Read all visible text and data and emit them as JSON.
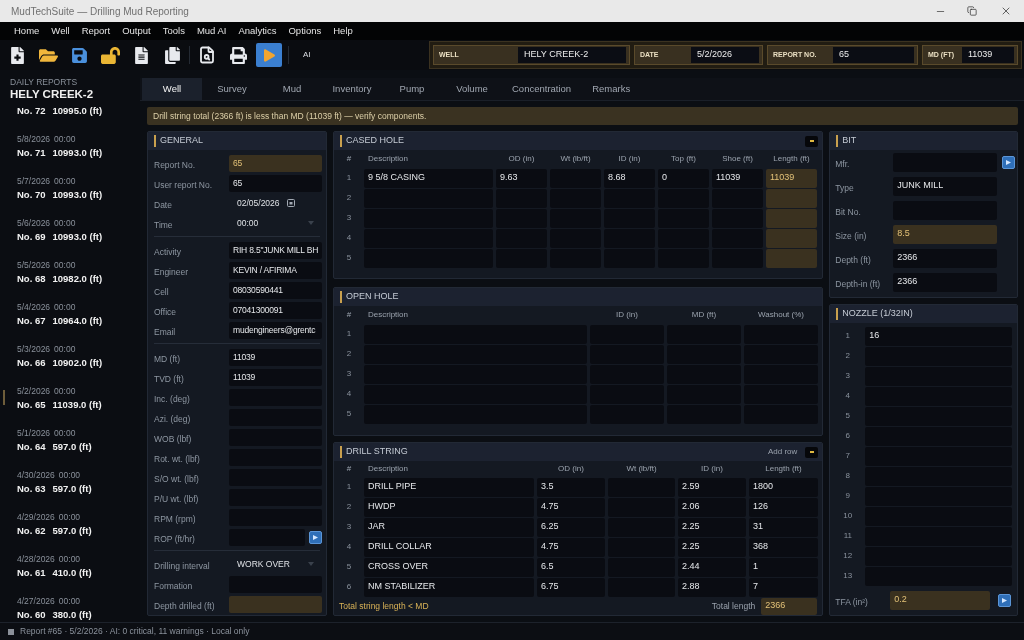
{
  "window": {
    "title": "MudTechSuite — Drilling Mud Reporting"
  },
  "menu": [
    "Home",
    "Well",
    "Report",
    "Output",
    "Tools",
    "Mud AI",
    "Analytics",
    "Options",
    "Help"
  ],
  "toolbar": {
    "groups": [
      {
        "buttons": [
          {
            "active": false
          },
          {
            "active": false
          },
          {
            "active": false
          },
          {
            "active": false
          },
          {
            "active": false
          },
          {
            "active": false
          }
        ]
      },
      {
        "buttons": [
          {
            "active": false
          },
          {
            "active": false
          },
          {
            "active": true
          }
        ]
      }
    ],
    "ai_button": "AI"
  },
  "header_fields": [
    {
      "label": "WELL",
      "value": "HELY CREEK-2"
    },
    {
      "label": "DATE",
      "value": "5/2/2026"
    },
    {
      "label": "REPORT NO.",
      "value": "65"
    },
    {
      "label": "MD (FT)",
      "value": "11039"
    }
  ],
  "sidebar": {
    "title": "DAILY REPORTS",
    "well": "HELY CREEK-2",
    "items": [
      {
        "number": "No. 72",
        "depth": "10995.0 (ft)",
        "selected": false
      },
      {
        "date": "5/8/2026",
        "time": "00:00",
        "number": "No. 71",
        "depth": "10993.0 (ft)",
        "selected": false
      },
      {
        "date": "5/7/2026",
        "time": "00:00",
        "number": "No. 70",
        "depth": "10993.0 (ft)",
        "selected": false
      },
      {
        "date": "5/6/2026",
        "time": "00:00",
        "number": "No. 69",
        "depth": "10993.0 (ft)",
        "selected": false
      },
      {
        "date": "5/5/2026",
        "time": "00:00",
        "number": "No. 68",
        "depth": "10982.0 (ft)",
        "selected": false
      },
      {
        "date": "5/4/2026",
        "time": "00:00",
        "number": "No. 67",
        "depth": "10964.0 (ft)",
        "selected": false
      },
      {
        "date": "5/3/2026",
        "time": "00:00",
        "number": "No. 66",
        "depth": "10902.0 (ft)",
        "selected": false
      },
      {
        "date": "5/2/2026",
        "time": "00:00",
        "number": "No. 65",
        "depth": "11039.0 (ft)",
        "selected": true
      },
      {
        "date": "5/1/2026",
        "time": "00:00",
        "number": "No. 64",
        "depth": "597.0 (ft)",
        "selected": false
      },
      {
        "date": "4/30/2026",
        "time": "00:00",
        "number": "No. 63",
        "depth": "597.0 (ft)",
        "selected": false
      },
      {
        "date": "4/29/2026",
        "time": "00:00",
        "number": "No. 62",
        "depth": "597.0 (ft)",
        "selected": false
      },
      {
        "date": "4/28/2026",
        "time": "00:00",
        "number": "No. 61",
        "depth": "410.0 (ft)",
        "selected": false
      },
      {
        "date": "4/27/2026",
        "time": "00:00",
        "number": "No. 60",
        "depth": "380.0 (ft)",
        "selected": false
      }
    ]
  },
  "tabs": [
    {
      "label": "Well",
      "selected": true
    },
    {
      "label": "Survey",
      "selected": false
    },
    {
      "label": "Mud",
      "selected": false
    },
    {
      "label": "Inventory",
      "selected": false
    },
    {
      "label": "Pump",
      "selected": false
    },
    {
      "label": "Volume",
      "selected": false
    },
    {
      "label": "Concentration",
      "selected": false
    },
    {
      "label": "Remarks",
      "selected": false
    }
  ],
  "warning": "Drill string total (2366 ft) is less than MD (11039 ft) — verify components.",
  "general": {
    "title": "GENERAL",
    "sections": [
      {
        "fields": [
          {
            "label": "Report No.",
            "kind": "text",
            "value": "65",
            "highlighted": true
          },
          {
            "label": "User report No.",
            "kind": "text",
            "value": "65",
            "highlighted": false
          },
          {
            "label": "Date",
            "kind": "date",
            "value": "02/05/2026",
            "highlighted": false
          },
          {
            "label": "Time",
            "kind": "time",
            "value": "00:00",
            "highlighted": false
          }
        ]
      },
      {
        "fields": [
          {
            "label": "Activity",
            "kind": "text",
            "value": "RIH 8.5\"JUNK MILL BH",
            "highlighted": false
          },
          {
            "label": "Engineer",
            "kind": "text",
            "value": "KEVIN / AFIRIMA",
            "highlighted": false
          },
          {
            "label": "Cell",
            "kind": "text",
            "value": "08030590441",
            "highlighted": false
          },
          {
            "label": "Office",
            "kind": "text",
            "value": "07041300091",
            "highlighted": false
          },
          {
            "label": "Email",
            "kind": "text",
            "value": "mudengineers@grentc",
            "highlighted": false
          }
        ]
      },
      {
        "fields": [
          {
            "label": "MD (ft)",
            "kind": "text",
            "value": "11039",
            "highlighted": false
          },
          {
            "label": "TVD (ft)",
            "kind": "text",
            "value": "11039",
            "highlighted": false
          },
          {
            "label": "Inc. (deg)",
            "kind": "text",
            "highlighted": false
          },
          {
            "label": "Azi. (deg)",
            "kind": "text",
            "highlighted": false
          },
          {
            "label": "WOB (lbf)",
            "kind": "text",
            "highlighted": false
          },
          {
            "label": "Rot. wt. (lbf)",
            "kind": "text",
            "highlighted": false
          },
          {
            "label": "S/O wt. (lbf)",
            "kind": "text",
            "highlighted": false
          },
          {
            "label": "P/U wt. (lbf)",
            "kind": "text",
            "highlighted": false
          },
          {
            "label": "RPM (rpm)",
            "kind": "text",
            "highlighted": false
          },
          {
            "label": "ROP (ft/hr)",
            "kind": "text_action",
            "highlighted": false
          }
        ]
      },
      {
        "fields": [
          {
            "label": "Drilling interval",
            "kind": "select",
            "value": "WORK OVER",
            "highlighted": false
          },
          {
            "label": "Formation",
            "kind": "text",
            "highlighted": false
          },
          {
            "label": "Depth drilled (ft)",
            "kind": "text",
            "highlighted": true
          }
        ]
      }
    ]
  },
  "cased_hole": {
    "title": "CASED HOLE",
    "collapsible": true,
    "columns": [
      {
        "label": "#",
        "highlighted": false
      },
      {
        "label": "Description",
        "highlighted": false
      },
      {
        "label": "OD (in)",
        "highlighted": false
      },
      {
        "label": "Wt (lb/ft)",
        "highlighted": false
      },
      {
        "label": "ID (in)",
        "highlighted": false
      },
      {
        "label": "Top (ft)",
        "highlighted": false
      },
      {
        "label": "Shoe (ft)",
        "highlighted": false
      },
      {
        "label": "Length (ft)",
        "highlighted": true
      }
    ],
    "rows": [
      {
        "cells": [
          {
            "value": "1"
          },
          {
            "value": "9 5/8 CASING"
          },
          {
            "value": "9.63"
          },
          {},
          {
            "value": "8.68"
          },
          {
            "value": "0"
          },
          {
            "value": "11039"
          },
          {
            "value": "11039"
          }
        ]
      },
      {
        "cells": [
          {
            "value": "2"
          },
          {},
          {},
          {},
          {},
          {},
          {},
          {}
        ]
      },
      {
        "cells": [
          {
            "value": "3"
          },
          {},
          {},
          {},
          {},
          {},
          {},
          {}
        ]
      },
      {
        "cells": [
          {
            "value": "4"
          },
          {},
          {},
          {},
          {},
          {},
          {},
          {}
        ]
      },
      {
        "cells": [
          {
            "value": "5"
          },
          {},
          {},
          {},
          {},
          {},
          {},
          {}
        ]
      }
    ]
  },
  "open_hole": {
    "title": "OPEN HOLE",
    "columns": [
      {
        "label": "#",
        "highlighted": false
      },
      {
        "label": "Description",
        "highlighted": false
      },
      {
        "label": "ID (in)",
        "highlighted": false
      },
      {
        "label": "MD (ft)",
        "highlighted": false
      },
      {
        "label": "Washout (%)",
        "highlighted": false
      }
    ],
    "rows": [
      {
        "cells": [
          {
            "value": "1"
          },
          {},
          {},
          {},
          {}
        ]
      },
      {
        "cells": [
          {
            "value": "2"
          },
          {},
          {},
          {},
          {}
        ]
      },
      {
        "cells": [
          {
            "value": "3"
          },
          {},
          {},
          {},
          {}
        ]
      },
      {
        "cells": [
          {
            "value": "4"
          },
          {},
          {},
          {},
          {}
        ]
      },
      {
        "cells": [
          {
            "value": "5"
          },
          {},
          {},
          {},
          {}
        ]
      }
    ]
  },
  "drill_string": {
    "title": "DRILL STRING",
    "collapsible": true,
    "add_row": "Add row",
    "columns": [
      {
        "label": "#",
        "highlighted": false
      },
      {
        "label": "Description",
        "highlighted": false
      },
      {
        "label": "OD (in)",
        "highlighted": false
      },
      {
        "label": "Wt (lb/ft)",
        "highlighted": false
      },
      {
        "label": "ID (in)",
        "highlighted": false
      },
      {
        "label": "Length (ft)",
        "highlighted": false
      }
    ],
    "rows": [
      {
        "cells": [
          {
            "value": "1"
          },
          {
            "value": "DRILL PIPE"
          },
          {
            "value": "3.5"
          },
          {},
          {
            "value": "2.59"
          },
          {
            "value": "1800"
          }
        ]
      },
      {
        "cells": [
          {
            "value": "2"
          },
          {
            "value": "HWDP"
          },
          {
            "value": "4.75"
          },
          {},
          {
            "value": "2.06"
          },
          {
            "value": "126"
          }
        ]
      },
      {
        "cells": [
          {
            "value": "3"
          },
          {
            "value": "JAR"
          },
          {
            "value": "6.25"
          },
          {},
          {
            "value": "2.25"
          },
          {
            "value": "31"
          }
        ]
      },
      {
        "cells": [
          {
            "value": "4"
          },
          {
            "value": "DRILL COLLAR"
          },
          {
            "value": "4.75"
          },
          {},
          {
            "value": "2.25"
          },
          {
            "value": "368"
          }
        ]
      },
      {
        "cells": [
          {
            "value": "5"
          },
          {
            "value": "CROSS OVER"
          },
          {
            "value": "6.5"
          },
          {},
          {
            "value": "2.44"
          },
          {
            "value": "1"
          }
        ]
      },
      {
        "cells": [
          {
            "value": "6"
          },
          {
            "value": "NM STABILIZER"
          },
          {
            "value": "6.75"
          },
          {},
          {
            "value": "2.88"
          },
          {
            "value": "7"
          }
        ]
      }
    ],
    "footer": {
      "warning": "Total string length < MD",
      "total_label": "Total length",
      "total_value": "2366",
      "total_highlighted": true
    }
  },
  "bit": {
    "title": "BIT",
    "fields": [
      {
        "label": "Mfr.",
        "kind": "text_action",
        "highlighted": false
      },
      {
        "label": "Type",
        "kind": "text",
        "value": "JUNK MILL",
        "highlighted": false
      },
      {
        "label": "Bit No.",
        "kind": "text",
        "highlighted": false
      },
      {
        "label": "Size (in)",
        "kind": "text",
        "value": "8.5",
        "highlighted": true
      },
      {
        "label": "Depth (ft)",
        "kind": "text",
        "value": "2366",
        "highlighted": false
      },
      {
        "label": "Depth-in (ft)",
        "kind": "text",
        "value": "2366",
        "highlighted": false
      }
    ]
  },
  "nozzle": {
    "title": "NOZZLE (1/32IN)",
    "rows": [
      {
        "number": "1",
        "value": "16"
      },
      {
        "number": "2"
      },
      {
        "number": "3"
      },
      {
        "number": "4"
      },
      {
        "number": "5"
      },
      {
        "number": "6"
      },
      {
        "number": "7"
      },
      {
        "number": "8"
      },
      {
        "number": "9"
      },
      {
        "number": "10"
      },
      {
        "number": "11"
      },
      {
        "number": "12"
      },
      {
        "number": "13"
      }
    ],
    "tfa": {
      "label": "TFA (in²)",
      "value": "0.2",
      "highlighted": true
    }
  },
  "status_bar": "Report #65 · 5/2/2026 · AI: 0 critical, 11 warnings · Local only"
}
